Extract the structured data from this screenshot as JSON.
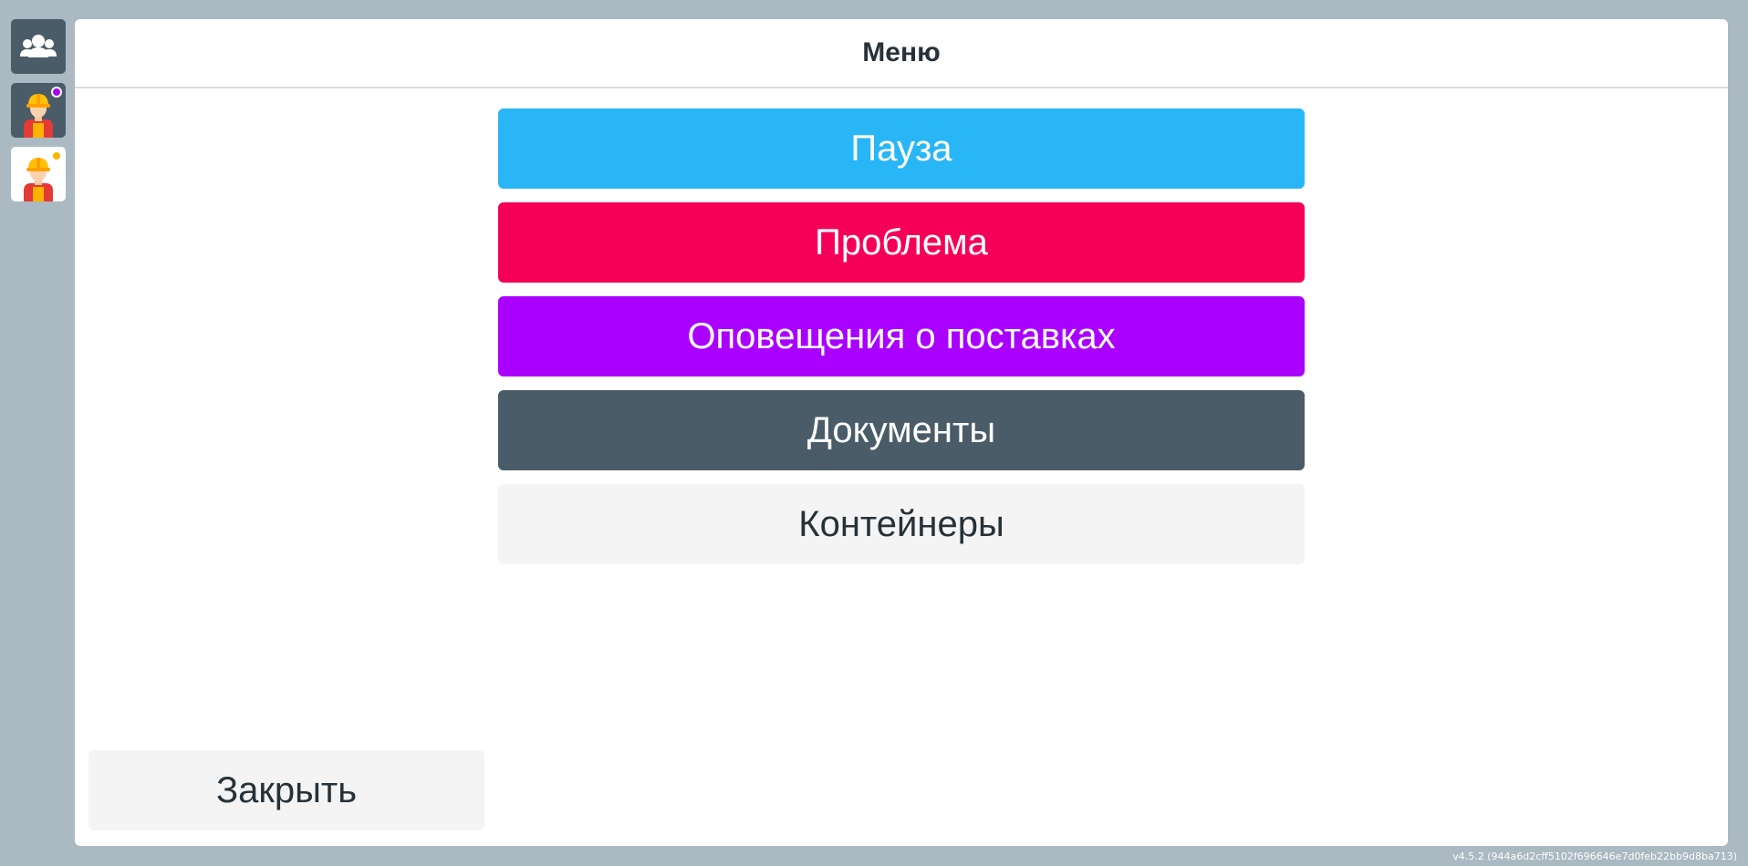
{
  "sidebar": {
    "items": [
      {
        "name": "users-group-icon",
        "style": "dark",
        "badge": null
      },
      {
        "name": "worker-avatar-icon",
        "style": "dark",
        "badge": "#aa00ff"
      },
      {
        "name": "worker-avatar-icon",
        "style": "light",
        "badge": "#ffb300"
      }
    ]
  },
  "menu": {
    "title": "Меню",
    "buttons": [
      {
        "label": "Пауза",
        "bg": "#29b6f6",
        "fg": "#ffffff"
      },
      {
        "label": "Проблема",
        "bg": "#f50057",
        "fg": "#ffffff"
      },
      {
        "label": "Оповещения о поставках",
        "bg": "#aa00ff",
        "fg": "#ffffff"
      },
      {
        "label": "Документы",
        "bg": "#4a5c68",
        "fg": "#ffffff"
      },
      {
        "label": "Контейнеры",
        "bg": "#f4f4f4",
        "fg": "#263238"
      }
    ],
    "close_label": "Закрыть",
    "close_bg": "#f4f4f4"
  },
  "footer": {
    "version": "v4.5.2 (944a6d2cff5102f696646e7d0feb22bb9d8ba713)"
  }
}
